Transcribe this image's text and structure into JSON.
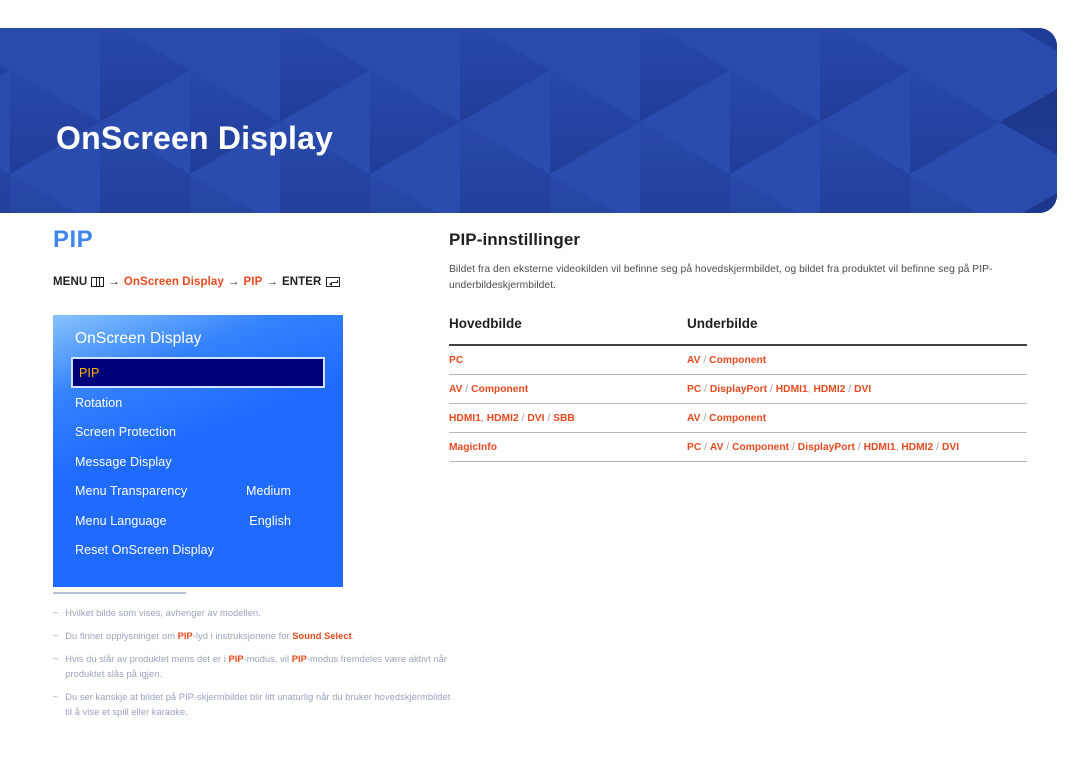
{
  "banner": {
    "title": "OnScreen Display",
    "bg_color": "#1f3c97",
    "pattern": "isometric-cubes"
  },
  "left": {
    "section_title": "PIP",
    "section_title_color": "#3f86f0",
    "menu_path": {
      "menu_label": "MENU",
      "menu_icon": "menu-bars-icon",
      "arrow": "→",
      "step1": "OnScreen Display",
      "step2": "PIP",
      "enter_label": "ENTER",
      "enter_icon": "enter-key-icon",
      "accent_color": "#e8491f"
    },
    "osd": {
      "title": "OnScreen Display",
      "selected_index": 0,
      "selected_text_color": "#ffb600",
      "selected_bg_color": "#00007a",
      "panel_color": "#1f6bff",
      "items": [
        {
          "label": "PIP",
          "value": ""
        },
        {
          "label": "Rotation",
          "value": ""
        },
        {
          "label": "Screen Protection",
          "value": ""
        },
        {
          "label": "Message Display",
          "value": ""
        },
        {
          "label": "Menu Transparency",
          "value": "Medium"
        },
        {
          "label": "Menu Language",
          "value": "English"
        },
        {
          "label": "Reset OnScreen Display",
          "value": ""
        }
      ]
    },
    "notes": [
      {
        "dash": "–",
        "parts": [
          {
            "t": "Hvilket bilde som vises, avhenger av modellen.",
            "b": false
          }
        ]
      },
      {
        "dash": "–",
        "parts": [
          {
            "t": "Du finner opplysninger om ",
            "b": false
          },
          {
            "t": "PIP",
            "b": true
          },
          {
            "t": "-lyd i instruksjonene for ",
            "b": false
          },
          {
            "t": "Sound Select",
            "b": true
          },
          {
            "t": ".",
            "b": false
          }
        ]
      },
      {
        "dash": "–",
        "parts": [
          {
            "t": "Hvis du slår av produktet mens det er i ",
            "b": false
          },
          {
            "t": "PIP",
            "b": true
          },
          {
            "t": "-modus, vil ",
            "b": false
          },
          {
            "t": "PIP",
            "b": true
          },
          {
            "t": "-modus fremdeles være aktivt når produktet slås på igjen.",
            "b": false
          }
        ]
      },
      {
        "dash": "–",
        "parts": [
          {
            "t": "Du ser kanskje at bildet på PIP-skjermbildet blir litt unaturlig når du bruker hovedskjermbildet til å vise et spill eller karaoke.",
            "b": false
          }
        ]
      }
    ]
  },
  "right": {
    "sub_title": "PIP-innstillinger",
    "description": "Bildet fra den eksterne videokilden vil befinne seg på hovedskjermbildet, og bildet fra produktet vil befinne seg på PIP-underbildeskjermbildet.",
    "table": {
      "headers": [
        "Hovedbilde",
        "Underbilde"
      ],
      "value_color": "#e8491f",
      "rows": [
        {
          "main": [
            {
              "t": "PC",
              "sep": false
            }
          ],
          "sub": [
            {
              "t": "AV",
              "sep": false
            },
            {
              "t": " / ",
              "sep": true
            },
            {
              "t": "Component",
              "sep": false
            }
          ]
        },
        {
          "main": [
            {
              "t": "AV",
              "sep": false
            },
            {
              "t": " / ",
              "sep": true
            },
            {
              "t": "Component",
              "sep": false
            }
          ],
          "sub": [
            {
              "t": "PC",
              "sep": false
            },
            {
              "t": " / ",
              "sep": true
            },
            {
              "t": "DisplayPort",
              "sep": false
            },
            {
              "t": " / ",
              "sep": true
            },
            {
              "t": "HDMI1",
              "sep": false
            },
            {
              "t": ", ",
              "sep": true
            },
            {
              "t": "HDMI2",
              "sep": false
            },
            {
              "t": " / ",
              "sep": true
            },
            {
              "t": "DVI",
              "sep": false
            }
          ]
        },
        {
          "main": [
            {
              "t": "HDMI1",
              "sep": false
            },
            {
              "t": ", ",
              "sep": true
            },
            {
              "t": "HDMI2",
              "sep": false
            },
            {
              "t": " / ",
              "sep": true
            },
            {
              "t": "DVI",
              "sep": false
            },
            {
              "t": " / ",
              "sep": true
            },
            {
              "t": "SBB",
              "sep": false
            }
          ],
          "sub": [
            {
              "t": "AV",
              "sep": false
            },
            {
              "t": " / ",
              "sep": true
            },
            {
              "t": "Component",
              "sep": false
            }
          ]
        },
        {
          "main": [
            {
              "t": "MagicInfo",
              "sep": false
            }
          ],
          "sub": [
            {
              "t": "PC",
              "sep": false
            },
            {
              "t": " / ",
              "sep": true
            },
            {
              "t": "AV",
              "sep": false
            },
            {
              "t": " / ",
              "sep": true
            },
            {
              "t": "Component",
              "sep": false
            },
            {
              "t": " / ",
              "sep": true
            },
            {
              "t": "DisplayPort",
              "sep": false
            },
            {
              "t": " / ",
              "sep": true
            },
            {
              "t": "HDMI1",
              "sep": false
            },
            {
              "t": ", ",
              "sep": true
            },
            {
              "t": "HDMI2",
              "sep": false
            },
            {
              "t": " / ",
              "sep": true
            },
            {
              "t": "DVI",
              "sep": false
            }
          ]
        }
      ]
    }
  }
}
